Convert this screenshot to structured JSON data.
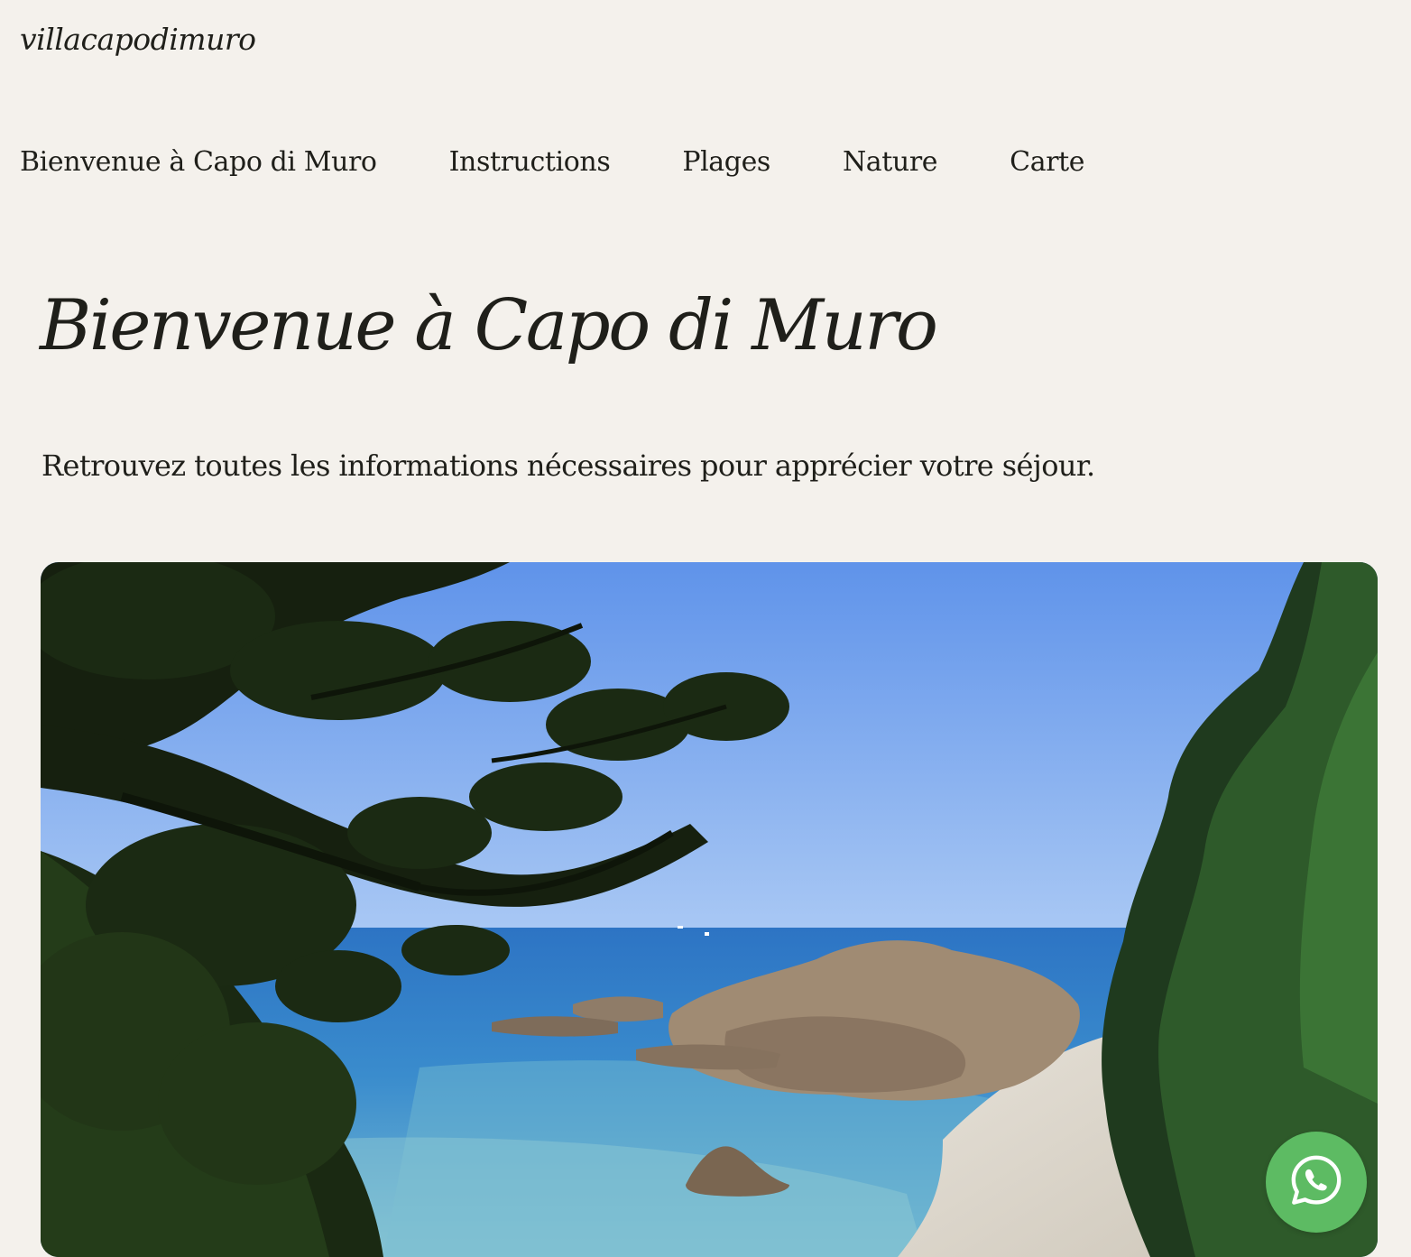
{
  "site": {
    "title": "villacapodimuro"
  },
  "nav": {
    "items": [
      {
        "label": "Bienvenue à Capo di Muro"
      },
      {
        "label": "Instructions"
      },
      {
        "label": "Plages"
      },
      {
        "label": "Nature"
      },
      {
        "label": "Carte"
      }
    ]
  },
  "hero": {
    "title": "Bienvenue à Capo di Muro",
    "subtitle": "Retrouvez toutes les informations nécessaires pour apprécier votre séjour."
  },
  "photo": {
    "subject": "coastal-cove-with-pines"
  },
  "whatsapp": {
    "icon": "whatsapp-icon",
    "color": "#5dbb63"
  },
  "colors": {
    "background": "#f4f1ec",
    "text": "#1f1f1a"
  }
}
